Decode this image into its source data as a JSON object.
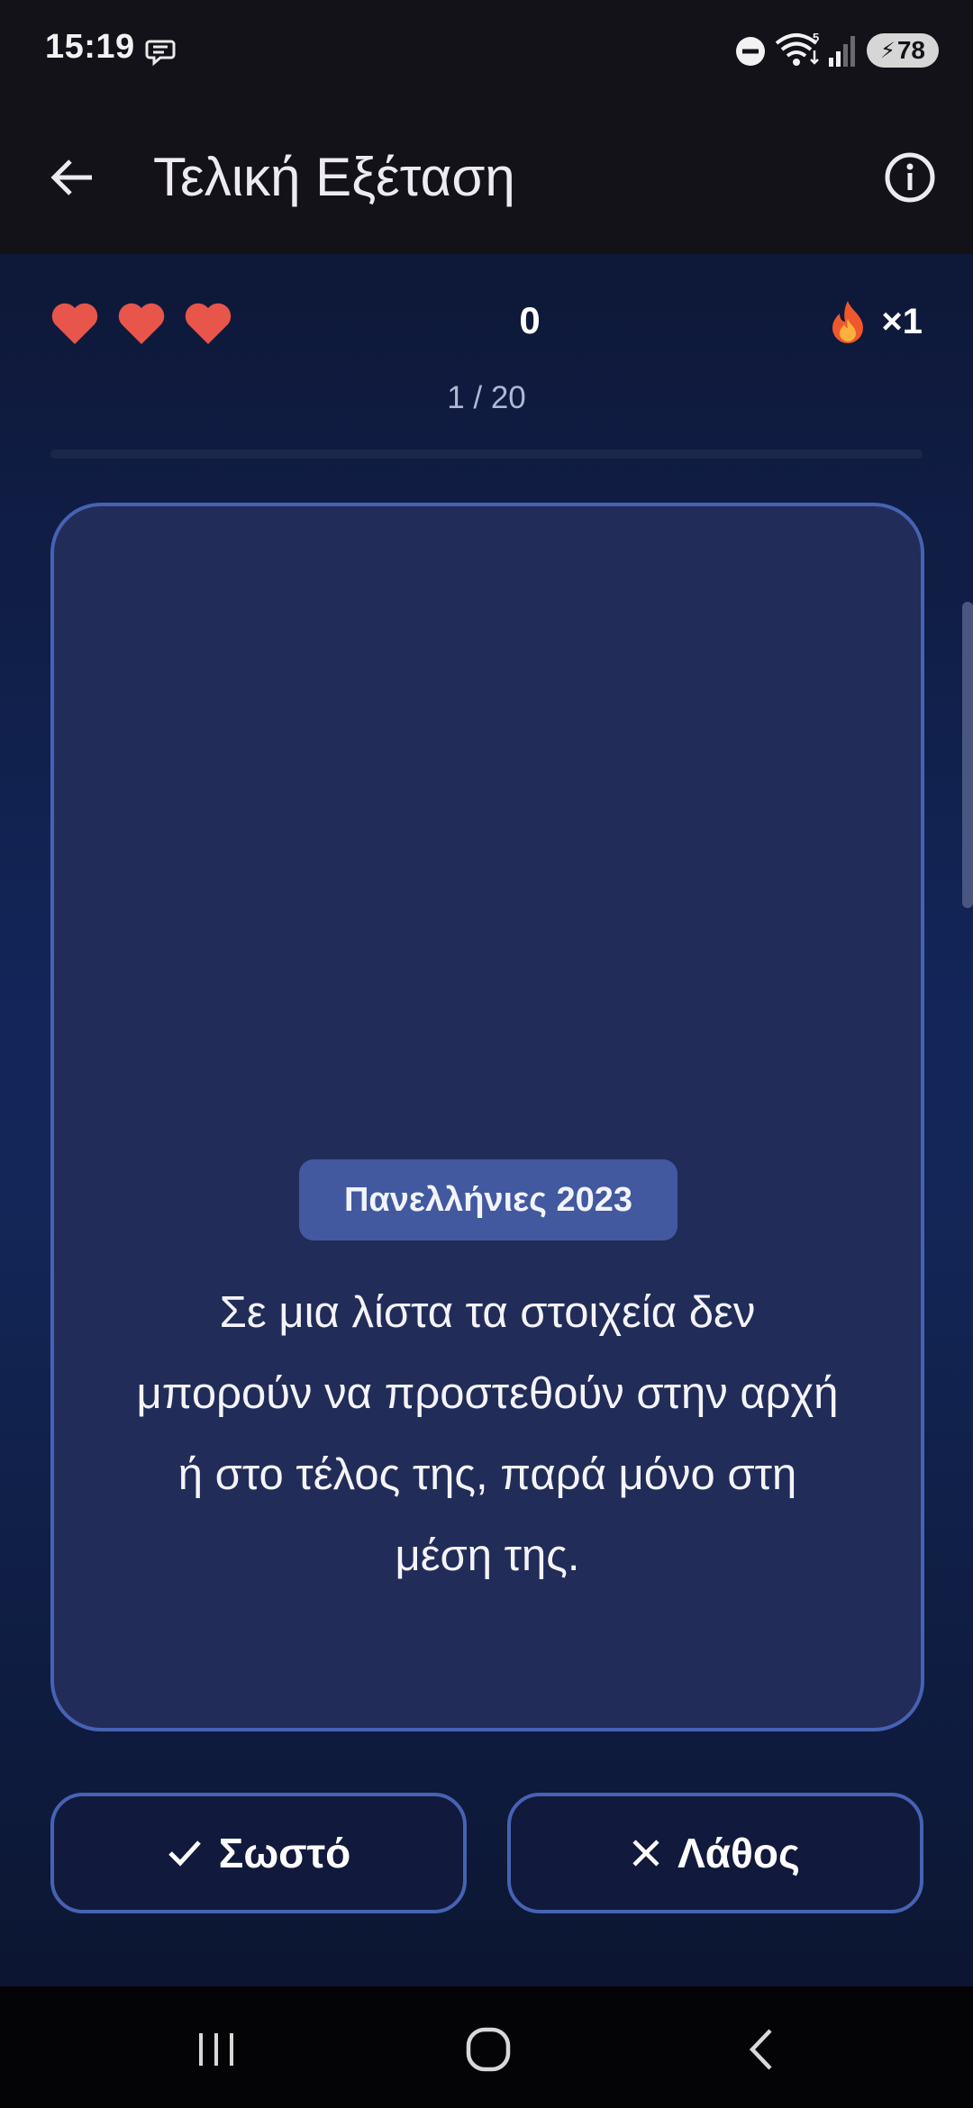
{
  "status_bar": {
    "time": "15:19",
    "battery": "78"
  },
  "app_bar": {
    "title": "Τελική Εξέταση"
  },
  "game": {
    "lives": 3,
    "score": "0",
    "streak": "×1",
    "progress_text": "1 / 20",
    "progress_fraction": 0.0
  },
  "question": {
    "badge": "Πανελλήνιες 2023",
    "text": "Σε μια λίστα τα στοιχεία δεν μπορούν να προστεθούν στην αρχή ή στο τέλος της, παρά μόνο στη μέση της."
  },
  "answers": {
    "true_label": "Σωστό",
    "false_label": "Λάθος"
  },
  "colors": {
    "heart": "#e8554a",
    "accent": "#4762b4",
    "card": "#212c59",
    "badge": "#42599f"
  },
  "icons": {
    "back": "arrow-left-icon",
    "info": "info-icon",
    "life": "heart-icon",
    "streak": "fire-icon",
    "true": "check-icon",
    "false": "x-icon"
  }
}
